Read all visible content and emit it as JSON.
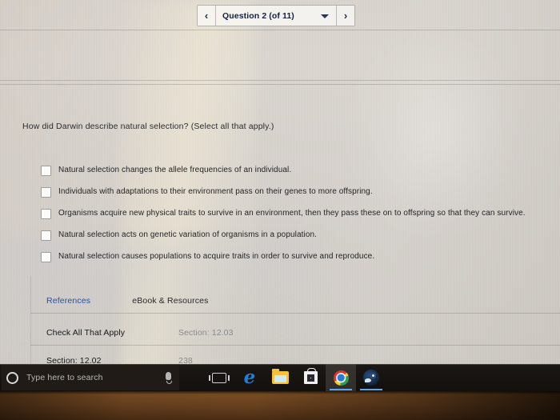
{
  "navigator": {
    "prev_label": "‹",
    "question_label": "Question 2 (of 11)",
    "next_label": "›",
    "dropdown_icon": "chevron-down-icon"
  },
  "question": {
    "stem": "How did Darwin describe natural selection? (Select all that apply.)",
    "options": [
      {
        "label": "Natural selection changes the allele frequencies of an individual.",
        "checked": false
      },
      {
        "label": "Individuals with adaptations to their environment pass on their genes to more offspring.",
        "checked": false
      },
      {
        "label": "Organisms acquire new physical traits to survive in an environment, then they pass these on to offspring so that they can survive.",
        "checked": false
      },
      {
        "label": "Natural selection acts on genetic variation of organisms in a population.",
        "checked": false
      },
      {
        "label": "Natural selection causes populations to acquire traits in order to survive and reproduce.",
        "checked": false
      }
    ]
  },
  "footer": {
    "tabs": [
      {
        "label": "References",
        "color": "#2453a6"
      },
      {
        "label": "eBook & Resources",
        "color": "#2a2a2c"
      }
    ],
    "rows": [
      {
        "title": "Check All That Apply",
        "meta": "Section: 12.03"
      },
      {
        "title": "Section: 12.02",
        "meta": "238"
      }
    ]
  },
  "taskbar": {
    "search_placeholder": "Type here to search",
    "cortana_icon": "cortana-circle-icon",
    "mic_icon": "microphone-icon",
    "items": [
      {
        "name": "task-view",
        "icon": "task-view-icon",
        "state": "idle"
      },
      {
        "name": "microsoft-edge",
        "icon": "edge-icon",
        "state": "idle"
      },
      {
        "name": "file-explorer",
        "icon": "folder-icon",
        "state": "idle"
      },
      {
        "name": "microsoft-store",
        "icon": "store-bag-icon",
        "state": "idle"
      },
      {
        "name": "google-chrome",
        "icon": "chrome-icon",
        "state": "active"
      },
      {
        "name": "steam",
        "icon": "steam-icon",
        "state": "open"
      }
    ]
  },
  "colors": {
    "link": "#2453a6",
    "meta": "#8a8a8c",
    "taskbar_bg": "#171310",
    "taskbar_underline": "#5ba7e8",
    "desk": "#6a4220"
  }
}
